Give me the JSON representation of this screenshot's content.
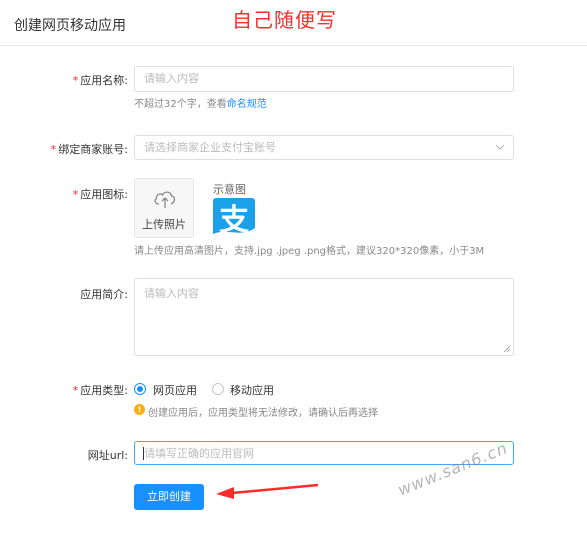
{
  "header": {
    "title": "创建网页移动应用",
    "handwritten_note": "自己随便写"
  },
  "form": {
    "app_name": {
      "label": "应用名称:",
      "placeholder": "请输入内容",
      "help_prefix": "不超过32个字，查看",
      "help_link": "命名规范"
    },
    "merchant_account": {
      "label": "绑定商家账号:",
      "placeholder": "请选择商家企业支付宝账号"
    },
    "app_icon": {
      "label": "应用图标:",
      "upload_label": "上传照片",
      "sample_label": "示意图",
      "sample_logo_text": "支",
      "help": "请上传应用高清图片，支持.jpg .jpeg .png格式，建议320*320像素，小于3M"
    },
    "app_intro": {
      "label": "应用简介:",
      "placeholder": "请输入内容"
    },
    "app_type": {
      "label": "应用类型:",
      "options": [
        {
          "label": "网页应用",
          "selected": true
        },
        {
          "label": "移动应用",
          "selected": false
        }
      ],
      "warning": "创建应用后，应用类型将无法修改，请确认后再选择"
    },
    "url": {
      "label": "网址url:",
      "placeholder": "请填写正确的应用官网"
    },
    "submit_label": "立即创建"
  },
  "watermark": "www.san6.cn",
  "colors": {
    "primary": "#1890ff",
    "required": "#f5222d",
    "warning": "#faad14",
    "annotation": "#ff2b2b"
  }
}
